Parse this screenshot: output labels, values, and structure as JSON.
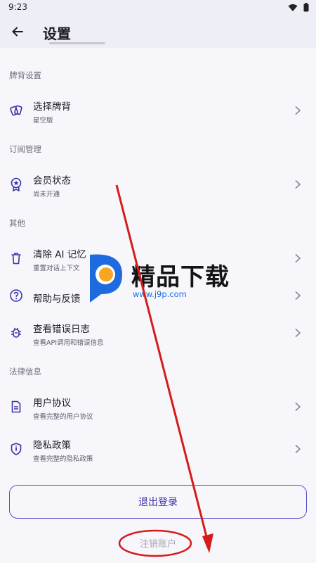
{
  "status_bar": {
    "time": "9:23"
  },
  "app_bar": {
    "title": "设置"
  },
  "sections": [
    {
      "header": "牌背设置",
      "items": [
        {
          "title": "选择牌背",
          "subtitle": "星空版",
          "icon": "cards-icon"
        }
      ]
    },
    {
      "header": "订阅管理",
      "items": [
        {
          "title": "会员状态",
          "subtitle": "尚未开通",
          "icon": "member-badge-icon"
        }
      ]
    },
    {
      "header": "其他",
      "items": [
        {
          "title": "清除 AI 记忆",
          "subtitle": "重置对话上下文",
          "icon": "trash-icon"
        },
        {
          "title": "帮助与反馈",
          "subtitle": "",
          "icon": "help-icon"
        },
        {
          "title": "查看错误日志",
          "subtitle": "查看API调用和错误信息",
          "icon": "bug-icon"
        }
      ]
    },
    {
      "header": "法律信息",
      "items": [
        {
          "title": "用户协议",
          "subtitle": "查看完整的用户协议",
          "icon": "document-icon"
        },
        {
          "title": "隐私政策",
          "subtitle": "查看完整的隐私政策",
          "icon": "shield-icon"
        }
      ]
    }
  ],
  "actions": {
    "logout": "退出登录",
    "delete_account": "注销账户"
  },
  "watermark": {
    "text": "精品下载",
    "url": "www.j9p.com"
  },
  "colors": {
    "primary": "#3c34a8",
    "annotation": "#d81a1a",
    "background": "#f6f6fb"
  }
}
